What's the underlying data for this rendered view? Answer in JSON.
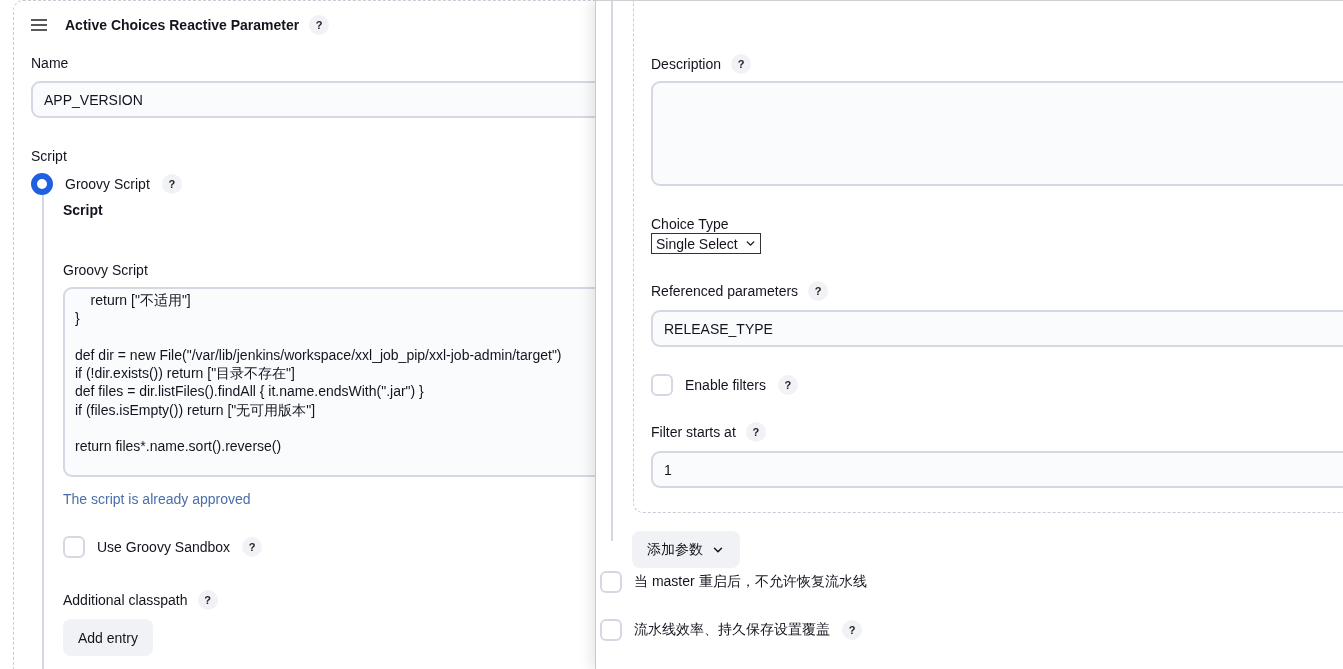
{
  "left": {
    "header": {
      "title": "Active Choices Reactive Parameter",
      "help": "?"
    },
    "name_field": {
      "label": "Name",
      "value": "APP_VERSION"
    },
    "script": {
      "label": "Script",
      "options": [
        {
          "label": "Groovy Script",
          "selected": true,
          "help": "?"
        }
      ],
      "section_title": "Script",
      "code_label": "Groovy Script",
      "code": "    return [\"不适用\"]\n}\n\ndef dir = new File(\"/var/lib/jenkins/workspace/xxl_job_pip/xxl-job-admin/target\")\nif (!dir.exists()) return [\"目录不存在\"]\ndef files = dir.listFiles().findAll { it.name.endsWith(\".jar\") }\nif (files.isEmpty()) return [\"无可用版本\"]\n\nreturn files*.name.sort().reverse()",
      "approval": "The script is already approved",
      "sandbox": {
        "label": "Use Groovy Sandbox",
        "checked": false,
        "help": "?"
      },
      "classpath": {
        "label": "Additional classpath",
        "help": "?",
        "button": "Add entry"
      }
    }
  },
  "right": {
    "description": {
      "label": "Description",
      "help": "?"
    },
    "choice_type": {
      "label": "Choice Type",
      "value": "Single Select"
    },
    "referenced": {
      "label": "Referenced parameters",
      "help": "?",
      "value": "RELEASE_TYPE"
    },
    "enable_filters": {
      "label": "Enable filters",
      "checked": false,
      "help": "?"
    },
    "filter_start": {
      "label": "Filter starts at",
      "help": "?",
      "value": "1"
    },
    "add_button": "添加参数",
    "options": [
      {
        "label": "当 master 重启后，不允许恢复流水线",
        "checked": false
      },
      {
        "label": "流水线效率、持久保存设置覆盖",
        "checked": false,
        "help": "?"
      }
    ]
  }
}
